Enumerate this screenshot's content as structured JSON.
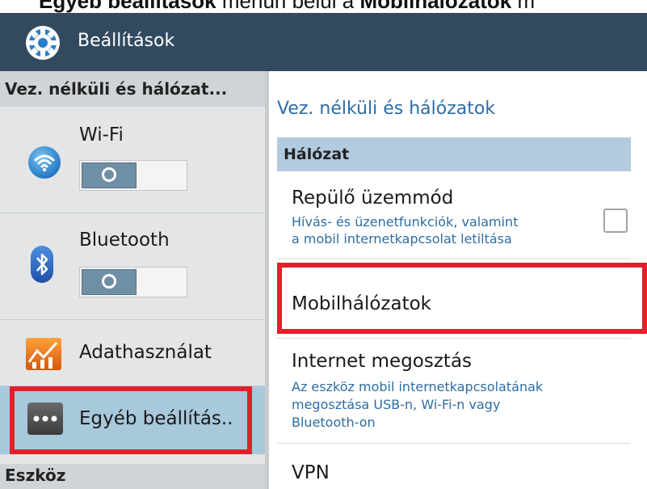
{
  "caption": {
    "part1": "Egyéb beállítások",
    "part2": " menün belül a ",
    "part3": "Mobilhálózatok",
    "part4": " m"
  },
  "actionbar": {
    "title": "Beállítások",
    "icon": "settings-gear-icon"
  },
  "left": {
    "header": "Vez. nélküli és hálózat...",
    "items": [
      {
        "label": "Wi-Fi",
        "icon": "wifi-icon",
        "toggle": "off"
      },
      {
        "label": "Bluetooth",
        "icon": "bluetooth-icon",
        "toggle": "off"
      },
      {
        "label": "Adathasználat",
        "icon": "data-usage-icon"
      },
      {
        "label": "Egyéb beállítás..",
        "icon": "more-dots-icon",
        "selected": true
      }
    ],
    "bottom_header": "Eszköz"
  },
  "right": {
    "title": "Vez. nélküli és hálózatok",
    "section": "Hálózat",
    "items": [
      {
        "title": "Repülő üzemmód",
        "subtitle_line1": "Hívás- és üzenetfunkciók, valamint",
        "subtitle_line2": "a mobil internetkapcsolat letiltása",
        "checked": false
      },
      {
        "title": "Mobilhálózatok"
      },
      {
        "title": "Internet megosztás",
        "subtitle_line1": "Az eszköz mobil internetkapcsolatának",
        "subtitle_line2": "megosztása USB-n, Wi-Fi-n vagy",
        "subtitle_line3": "Bluetooth-on"
      },
      {
        "title": "VPN"
      }
    ]
  },
  "colors": {
    "actionbar": "#324a60",
    "accent_text": "#2e6da4",
    "selected": "#a8c8dc",
    "highlight": "#e3202a"
  }
}
